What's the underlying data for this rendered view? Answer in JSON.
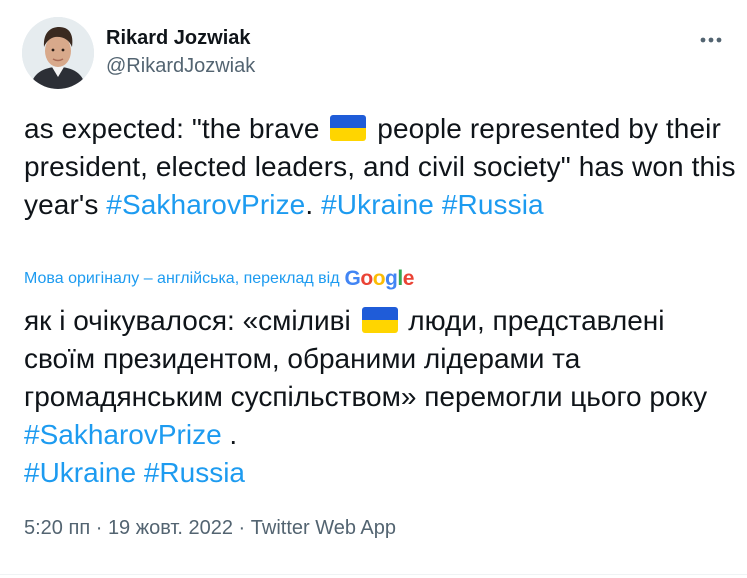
{
  "author": {
    "display_name": "Rikard Jozwiak",
    "handle": "@RikardJozwiak"
  },
  "tweet": {
    "seg1": "as expected: \"the brave ",
    "seg2": " people represented by their president, elected leaders, and civil society\" has won this year's ",
    "hashtag1": "#SakharovPrize",
    "seg3": ".  ",
    "hashtag2": "#Ukraine",
    "seg4": " ",
    "hashtag3": "#Russia"
  },
  "translation": {
    "note": "Мова оригіналу – англійська, переклад від",
    "provider": "Google",
    "seg1": "як і очікувалося: «сміливі ",
    "seg2": " люди, представлені своїм президентом, обраними лідерами та громадянським суспільством» перемогли цього року ",
    "hashtag1": "#SakharovPrize",
    "seg3": " . ",
    "hashtag2": "#Ukraine",
    "seg4": " ",
    "hashtag3": "#Russia"
  },
  "meta": {
    "time": "5:20 пп",
    "sep1": " · ",
    "date": "19 жовт. 2022",
    "sep2": " · ",
    "app": "Twitter Web App"
  },
  "icons": {
    "more": "more-horizontal-icon",
    "flag": "ukraine-flag-icon"
  },
  "colors": {
    "link": "#1d9bf0",
    "text": "#0f1419",
    "secondary": "#536471",
    "flag_blue": "#1f5cd8",
    "flag_yellow": "#ffd500"
  }
}
